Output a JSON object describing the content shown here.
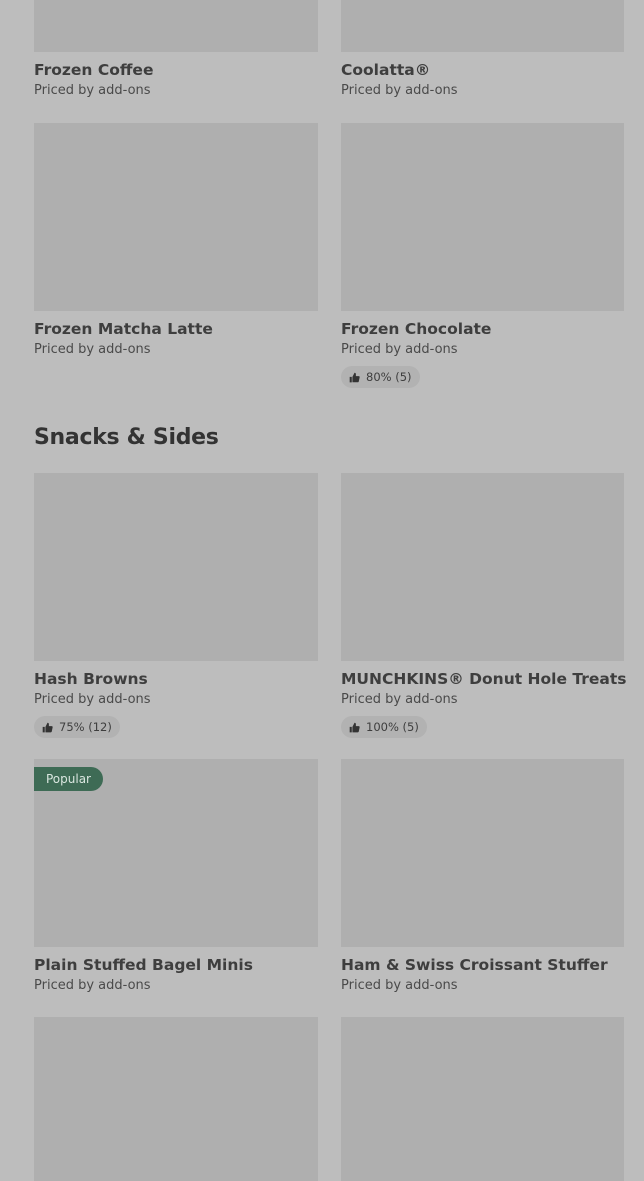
{
  "colors": {
    "background": "#bdbdbd",
    "thumbnail": "#afafaf",
    "badge": "#3e6b55",
    "badge_text": "#d9e6df"
  },
  "rows": [
    {
      "items": [
        {
          "name": "Frozen Coffee",
          "price": "Priced by add-ons"
        },
        {
          "name": "Coolatta®",
          "price": "Priced by add-ons"
        }
      ]
    },
    {
      "items": [
        {
          "name": "Frozen Matcha Latte",
          "price": "Priced by add-ons"
        },
        {
          "name": "Frozen Chocolate",
          "price": "Priced by add-ons",
          "rating": "80% (5)",
          "rating_icon": "thumbs-up-icon"
        }
      ]
    }
  ],
  "section": {
    "title": "Snacks & Sides"
  },
  "snacks": [
    {
      "name": "Hash Browns",
      "price": "Priced by add-ons",
      "rating": "75% (12)",
      "rating_icon": "thumbs-up-icon"
    },
    {
      "name": "MUNCHKINS® Donut Hole Treats",
      "price": "Priced by add-ons",
      "rating": "100% (5)",
      "rating_icon": "thumbs-up-icon"
    },
    {
      "name": "Plain Stuffed Bagel Minis",
      "price": "Priced by add-ons",
      "badge": "Popular"
    },
    {
      "name": "Ham & Swiss Croissant Stuffer",
      "price": "Priced by add-ons"
    }
  ]
}
